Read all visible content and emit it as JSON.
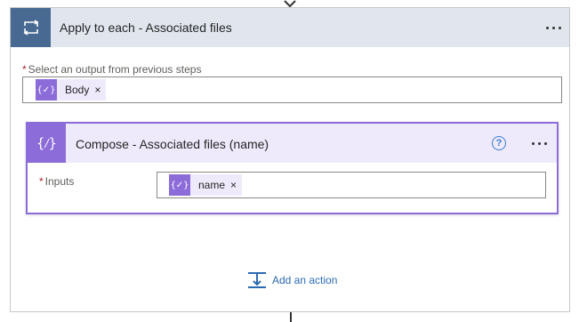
{
  "loop": {
    "title": "Apply to each - Associated files",
    "field_label": "Select an output from previous steps",
    "required_mark": "*",
    "token": {
      "label": "Body",
      "remove": "×",
      "icon": "{✓}"
    }
  },
  "compose": {
    "title": "Compose - Associated files (name)",
    "help": "?",
    "inputs_label": "Inputs",
    "required_mark": "*",
    "token": {
      "label": "name",
      "remove": "×",
      "icon": "{✓}"
    }
  },
  "add_action": {
    "label": "Add an action"
  },
  "colors": {
    "loop_header": "#486991",
    "compose_accent": "#8c6cd9",
    "link": "#2b6ab3"
  },
  "icons": {
    "loop": "loop-icon",
    "compose": "compose-icon",
    "more": "more-icon",
    "help": "help-icon",
    "add_action": "add-action-icon"
  }
}
